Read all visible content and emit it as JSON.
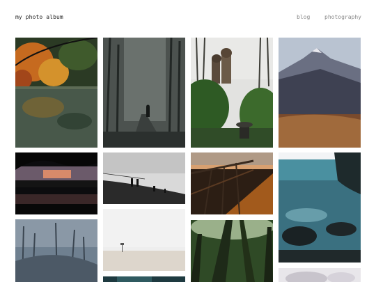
{
  "header": {
    "title": "my photo album",
    "nav": [
      {
        "label": "blog"
      },
      {
        "label": "photography"
      }
    ]
  },
  "gallery": {
    "photos": [
      {
        "subject": "autumn-lake-trees"
      },
      {
        "subject": "foggy-forest-path-person"
      },
      {
        "subject": "villa-garden-statue"
      },
      {
        "subject": "mountain-meadow"
      },
      {
        "subject": "sunset-lake-silhouette"
      },
      {
        "subject": "windy-hill-figures-bw"
      },
      {
        "subject": "wooden-pier-sunset"
      },
      {
        "subject": "rocky-sea-coast"
      },
      {
        "subject": "misty-winter-trees"
      },
      {
        "subject": "foggy-beach-sign"
      },
      {
        "subject": "forest-canopy-upward"
      },
      {
        "subject": "dark-teal-photo-partial"
      },
      {
        "subject": "bright-photo-partial"
      }
    ]
  }
}
